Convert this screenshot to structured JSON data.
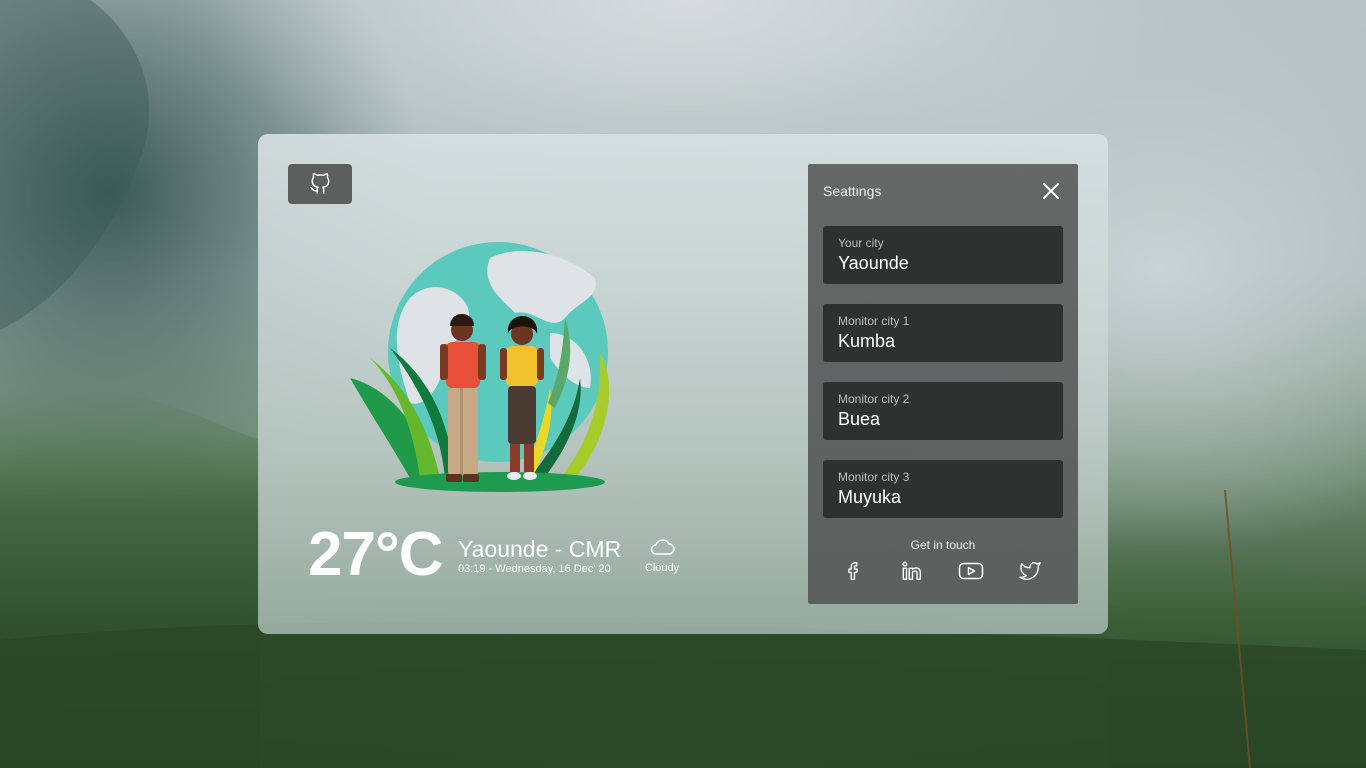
{
  "weather": {
    "temperature": "27°C",
    "city": "Yaounde - CMR",
    "datetime": "03:19 - Wednesday, 16 Dec' 20",
    "condition": "Cloudy"
  },
  "settings": {
    "title": "Seattings",
    "fields": [
      {
        "label": "Your city",
        "value": "Yaounde"
      },
      {
        "label": "Monitor city 1",
        "value": "Kumba"
      },
      {
        "label": "Monitor city 2",
        "value": "Buea"
      },
      {
        "label": "Monitor city 3",
        "value": "Muyuka"
      }
    ],
    "get_in_touch": "Get in touch"
  },
  "icons": {
    "github": "github-icon",
    "close": "close-icon",
    "cloud": "cloud-icon",
    "socials": [
      "facebook-icon",
      "linkedin-icon",
      "youtube-icon",
      "twitter-icon"
    ]
  },
  "colors": {
    "settings_panel": "#5e6261",
    "field_bg": "#2f3131",
    "github_button": "#5b605f",
    "text_light": "#ffffff"
  }
}
